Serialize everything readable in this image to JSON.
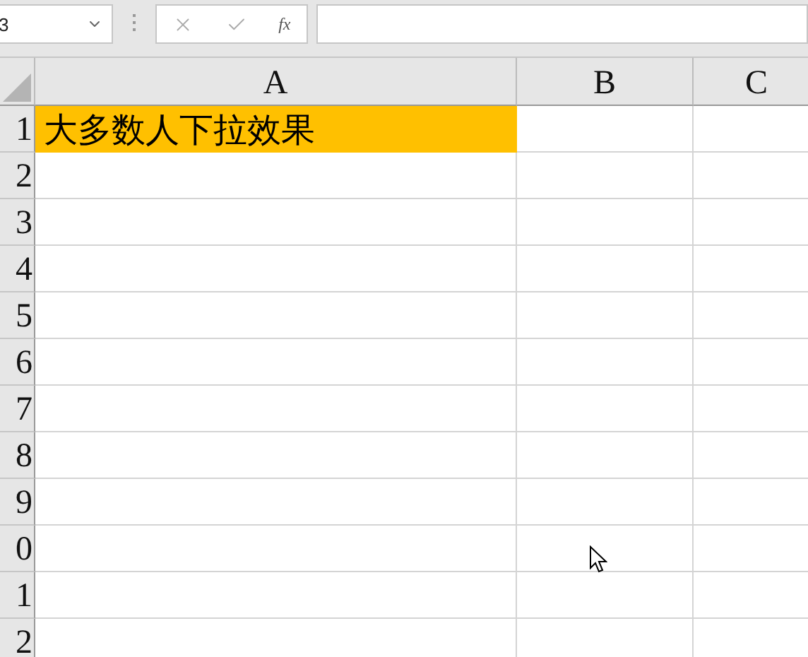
{
  "formula_bar": {
    "name_box": "3",
    "function_label": "fx"
  },
  "columns": [
    {
      "label": "A",
      "selected": false
    },
    {
      "label": "B",
      "selected": false
    },
    {
      "label": "C",
      "selected": false
    }
  ],
  "rows": [
    {
      "label": "1",
      "cells": [
        {
          "text": "大多数人下拉效果",
          "color": "#ffc000"
        }
      ]
    },
    {
      "label": "2"
    },
    {
      "label": "3"
    },
    {
      "label": "4"
    },
    {
      "label": "5"
    },
    {
      "label": "6"
    },
    {
      "label": "7"
    },
    {
      "label": "8"
    },
    {
      "label": "9"
    },
    {
      "label": "0"
    },
    {
      "label": "1"
    },
    {
      "label": "2"
    }
  ]
}
